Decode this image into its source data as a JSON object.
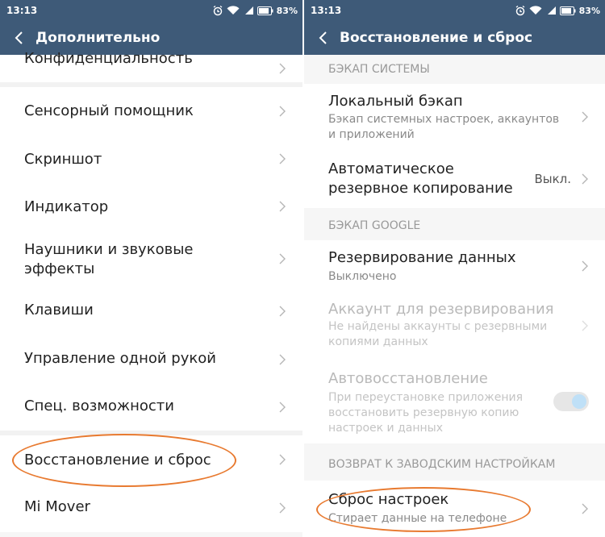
{
  "left": {
    "status": {
      "time": "13:13",
      "battery": "83%"
    },
    "title": "Дополнительно",
    "items": [
      {
        "label": "Конфиденциальность"
      },
      {
        "label": "Сенсорный помощник"
      },
      {
        "label": "Скриншот"
      },
      {
        "label": "Индикатор"
      },
      {
        "label": "Наушники и звуковые\nэффекты"
      },
      {
        "label": "Клавиши"
      },
      {
        "label": "Управление одной рукой"
      },
      {
        "label": "Спец. возможности"
      },
      {
        "label": "Восстановление и сброс"
      },
      {
        "label": "Mi Mover"
      }
    ]
  },
  "right": {
    "status": {
      "time": "13:13",
      "battery": "83%"
    },
    "title": "Восстановление и сброс",
    "sections": [
      {
        "header": "БЭКАП СИСТЕМЫ"
      },
      {
        "header": "БЭКАП GOOGLE"
      },
      {
        "header": "ВОЗВРАТ К ЗАВОДСКИМ НАСТРОЙКАМ"
      }
    ],
    "items": [
      {
        "title": "Локальный бэкап",
        "subtitle": "Бэкап системных настроек, аккаунтов\nи приложений"
      },
      {
        "title": "Автоматическое\nрезервное копирование",
        "value": "Выкл."
      },
      {
        "title": "Резервирование данных",
        "subtitle": "Выключено"
      },
      {
        "title": "Аккаунт для резервирования",
        "subtitle": "Не найдены аккаунты с резервными\nкопиями данных"
      },
      {
        "title": "Автовосстановление",
        "subtitle": "При переустановке приложения\nвосстановить резервную копию\nнастроек и данных"
      },
      {
        "title": "Сброс настроек",
        "subtitle": "Стирает данные на телефоне"
      }
    ]
  },
  "colors": {
    "bar": "#3e5a78",
    "highlight_ring": "#e87a30",
    "toggle_knob": "#bfe0f7"
  },
  "icons": [
    "back-arrow-icon",
    "chevron-right-icon",
    "alarm-icon",
    "wifi-icon",
    "signal-icon",
    "battery-icon"
  ]
}
